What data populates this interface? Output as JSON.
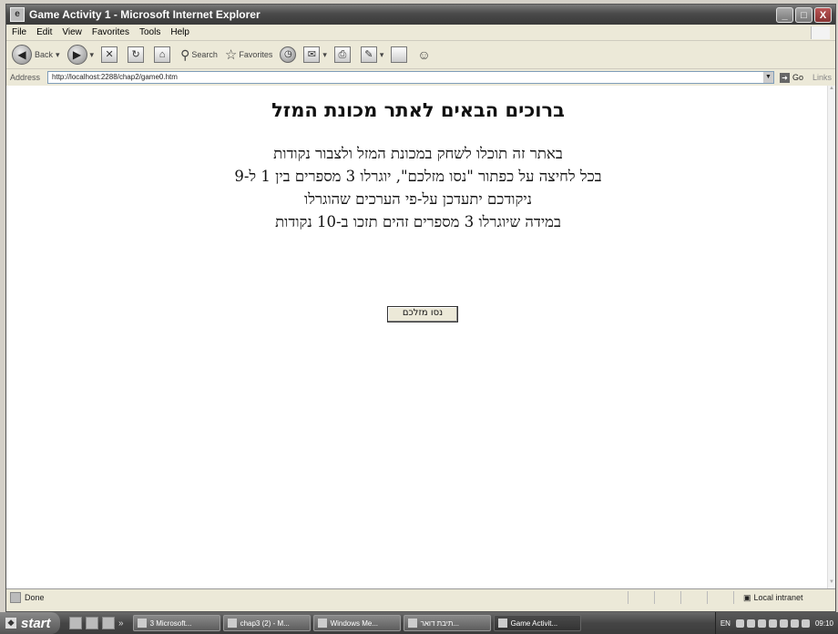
{
  "window": {
    "title": "Game Activity 1 - Microsoft Internet Explorer",
    "minimize": "_",
    "maximize": "□",
    "close": "X"
  },
  "menu": [
    "File",
    "Edit",
    "View",
    "Favorites",
    "Tools",
    "Help"
  ],
  "toolbar": {
    "back": "Back",
    "search": "Search",
    "favorites": "Favorites"
  },
  "address": {
    "label": "Address",
    "url": "http://localhost:2288/chap2/game0.htm",
    "go": "Go",
    "links": "Links"
  },
  "page": {
    "heading": "ברוכים הבאים לאתר מכונת המזל",
    "lines": [
      "באתר זה תוכלו לשחק במכונת המזל ולצבור נקודות",
      "בכל לחיצה על כפתור \"נסו מזלכם\", יוגרלו 3 מספרים בין 1 ל-9",
      "ניקודכם יתעדכן על-פי הערכים שהוגרלו",
      "במידה שיוגרלו 3 מספרים זהים תזכו ב-10 נקודות"
    ],
    "button": "נסו מזלכם"
  },
  "status": {
    "text": "Done",
    "zone": "Local intranet"
  },
  "taskbar": {
    "start": "start",
    "tasks": [
      "3 Microsoft...",
      "chap3 (2) - M...",
      "Windows Me...",
      "תיבת דואר...",
      "Game Activit..."
    ],
    "lang": "EN",
    "clock": "09:10"
  },
  "icons": [
    "ie-icon",
    "back-arrow-icon",
    "forward-arrow-icon",
    "stop-icon",
    "refresh-icon",
    "home-icon",
    "search-icon",
    "favorites-star-icon",
    "history-icon",
    "mail-icon",
    "print-icon",
    "edit-icon",
    "discuss-icon",
    "messenger-icon",
    "windows-logo-icon"
  ]
}
